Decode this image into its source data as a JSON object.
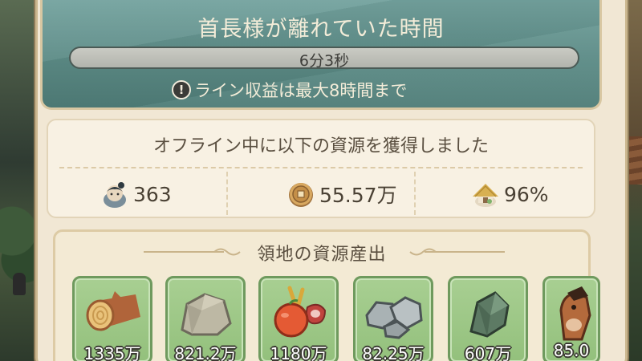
{
  "header": {
    "title": "首長様が離れていた時間",
    "elapsed_time": "6分3秒",
    "notice": "ライン収益は最大8時間まで",
    "notice_icon": "exclamation-icon"
  },
  "offline": {
    "title": "オフライン中に以下の資源を獲得しました",
    "stats": [
      {
        "icon": "population-icon",
        "value": "363"
      },
      {
        "icon": "coin-icon",
        "value": "55.57万"
      },
      {
        "icon": "happiness-hut-icon",
        "value": "96%"
      }
    ]
  },
  "territory": {
    "title": "領地の資源産出",
    "resources": [
      {
        "icon": "wood-log-icon",
        "amount": "1335万"
      },
      {
        "icon": "stone-icon",
        "amount": "821.2万"
      },
      {
        "icon": "food-icon",
        "amount": "1180万"
      },
      {
        "icon": "ore-icon",
        "amount": "82.25万"
      },
      {
        "icon": "jade-icon",
        "amount": "607万"
      },
      {
        "icon": "horse-icon",
        "amount": "85.0"
      }
    ]
  },
  "colors": {
    "header_teal": "#5c8b86",
    "card_green": "#9cc886",
    "panel_cream": "#f1e7d4"
  }
}
